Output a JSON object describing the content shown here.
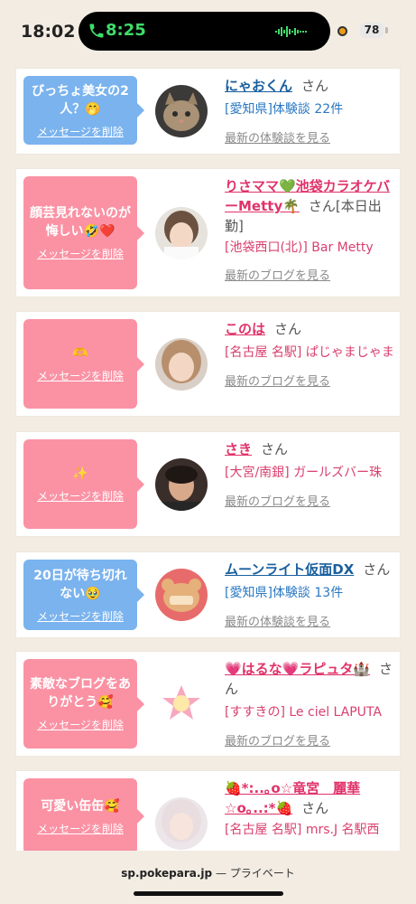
{
  "status": {
    "time": "18:02",
    "call_time": "8:25",
    "battery": "78"
  },
  "cards": [
    {
      "kind": "blue",
      "message": "びっちょ美女の2人？🤭",
      "delete": "メッセージを削除",
      "name": "にゃおくん",
      "san": "さん",
      "desc": "[愛知県]体験談 22件",
      "link": "最新の体験談を見る"
    },
    {
      "kind": "pink",
      "message": "顔芸見れないのが悔しい🤣❤️",
      "delete": "メッセージを削除",
      "name": "りさママ💚池袋カラオケバーMetty🌴",
      "san": "さん[本日出勤]",
      "desc": "[池袋西口(北)] Bar Metty",
      "link": "最新のブログを見る"
    },
    {
      "kind": "pink",
      "message": "🫶",
      "delete": "メッセージを削除",
      "name": "このは",
      "san": "さん",
      "desc": "[名古屋 名駅] ぱじゃまじゃま",
      "link": "最新のブログを見る"
    },
    {
      "kind": "pink",
      "message": "✨",
      "delete": "メッセージを削除",
      "name": "さき",
      "san": "さん",
      "desc": "[大宮/南銀] ガールズバー珠",
      "link": "最新のブログを見る"
    },
    {
      "kind": "blue",
      "message": "20日が待ち切れない🥹",
      "delete": "メッセージを削除",
      "name": "ムーンライト仮面DX",
      "san": "さん",
      "desc": "[愛知県]体験談 13件",
      "link": "最新の体験談を見る"
    },
    {
      "kind": "pink",
      "message": "素敵なブログをありがとう🥰",
      "delete": "メッセージを削除",
      "name": "💗はるな💗ラピュタ🏰",
      "san": "さん",
      "desc": "[すすきの] Le ciel LAPUTA",
      "link": "最新のブログを見る"
    },
    {
      "kind": "pink",
      "message": "可愛い缶缶🥰",
      "delete": "メッセージを削除",
      "name": "🍓*:..｡o☆竜宮　麗華☆o｡..:*🍓",
      "san": "さん",
      "desc": "[名古屋 名駅] mrs.J 名駅西",
      "link": ""
    }
  ],
  "bottom": {
    "host": "sp.pokepara.jp",
    "suffix": " — プライベート"
  },
  "colors": {
    "blue": "#7ab3ee",
    "pink": "#fa92a4",
    "bg": "#f2ece2"
  }
}
